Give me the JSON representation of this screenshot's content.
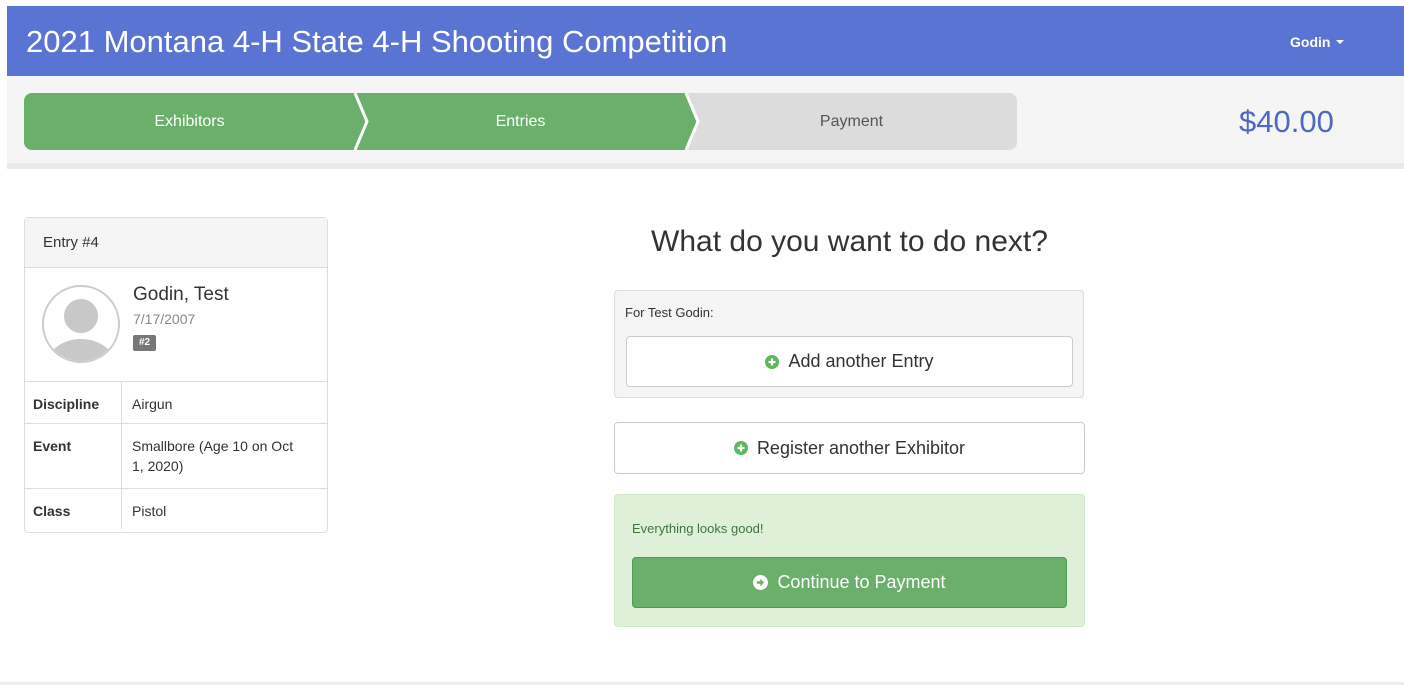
{
  "header": {
    "title": "2021 Montana 4-H State 4-H Shooting Competition",
    "user": "Godin",
    "bg_color": "#5a74d3"
  },
  "steps": [
    {
      "label": "Exhibitors",
      "state": "complete"
    },
    {
      "label": "Entries",
      "state": "current"
    },
    {
      "label": "Payment",
      "state": "pending"
    }
  ],
  "total": "$40.00",
  "entry_card": {
    "title": "Entry #4",
    "exhibitor": {
      "name": "Godin, Test",
      "dob": "7/17/2007",
      "badge": "#2"
    },
    "details": [
      {
        "label": "Discipline",
        "value": "Airgun"
      },
      {
        "label": "Event",
        "value": "Smallbore (Age 10 on Oct 1, 2020)"
      },
      {
        "label": "Class",
        "value": "Pistol"
      }
    ]
  },
  "next": {
    "heading": "What do you want to do next?",
    "for_label": "For Test Godin:",
    "add_entry_label": "Add another Entry",
    "register_label": "Register another Exhibitor",
    "success_message": "Everything looks good!",
    "continue_label": "Continue to Payment"
  },
  "colors": {
    "step_complete": "#6aaf6a",
    "step_pending": "#dcdcdc",
    "success_bg": "#dff0d8",
    "total_color": "#4e68c4"
  },
  "icons": {
    "add_entry": "plus-circle-icon",
    "register": "plus-circle-icon",
    "continue": "arrow-circle-right-icon",
    "user_menu": "caret-down-icon",
    "avatar": "user-silhouette-icon"
  }
}
